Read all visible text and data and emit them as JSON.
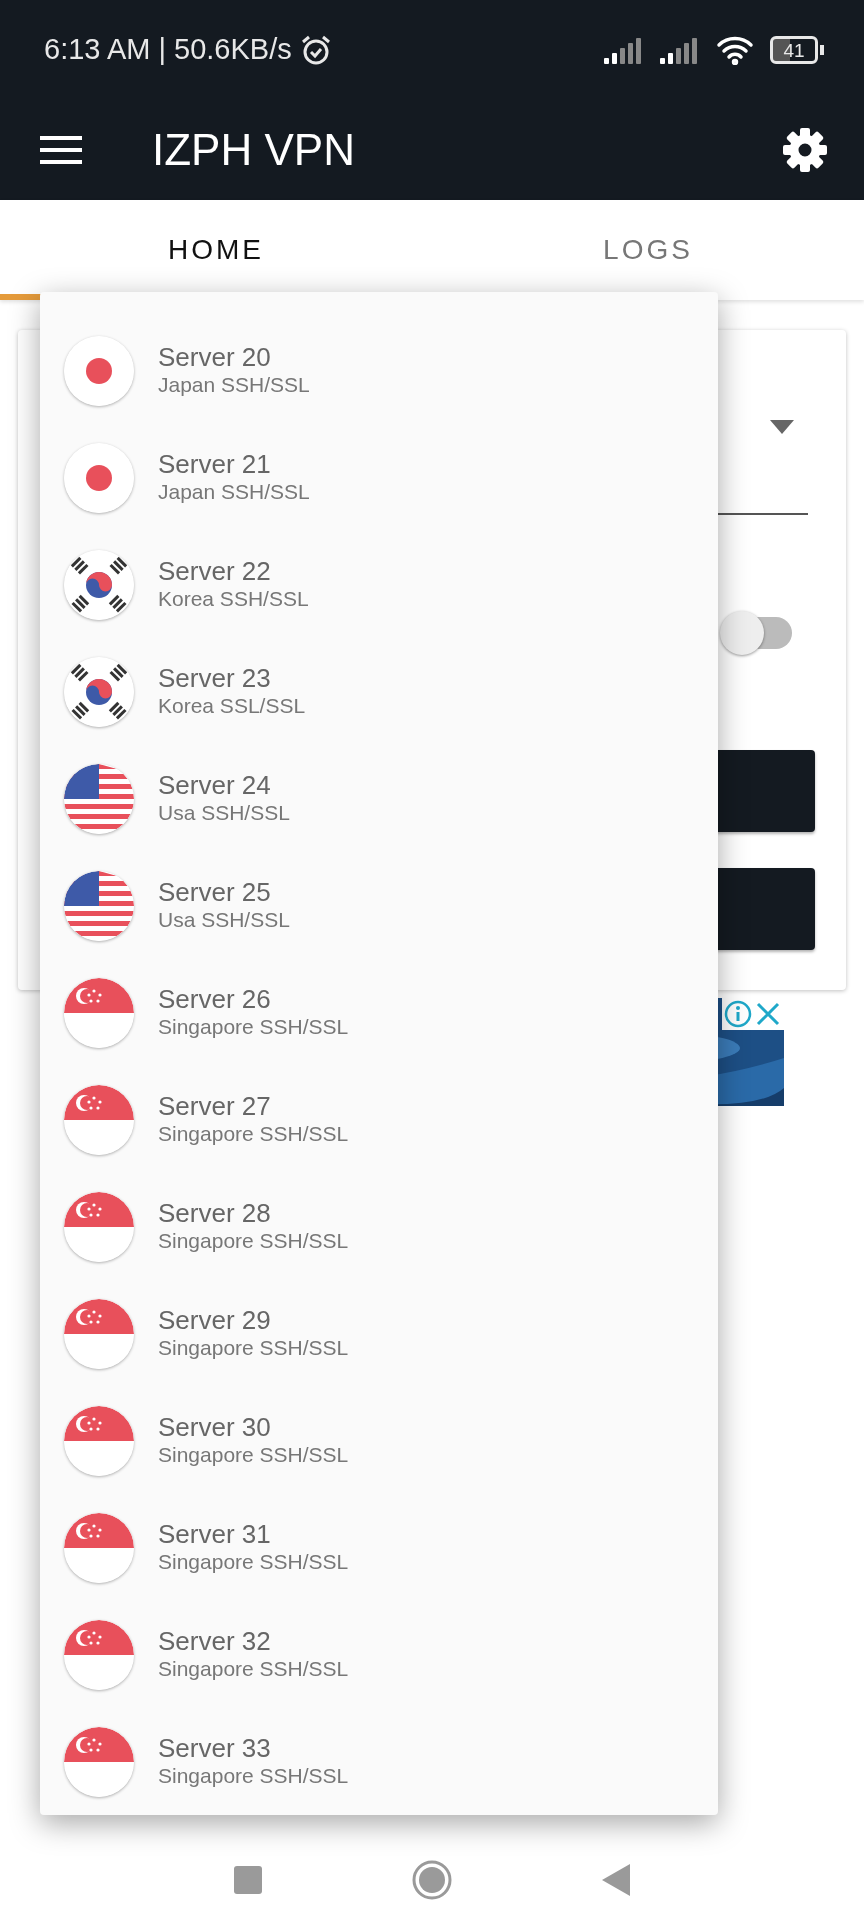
{
  "status_bar": {
    "time_speed": "6:13 AM | 50.6KB/s",
    "battery": "41"
  },
  "toolbar": {
    "title": "IZPH VPN"
  },
  "tabs": [
    {
      "label": "HOME",
      "selected": true
    },
    {
      "label": "LOGS",
      "selected": false
    }
  ],
  "home_card": {
    "toggle_on": false
  },
  "server_menu": [
    {
      "name": "Server 20",
      "protocol": "Japan SSH/SSL",
      "kind": "japan"
    },
    {
      "name": "Server 21",
      "protocol": "Japan SSH/SSL",
      "kind": "japan"
    },
    {
      "name": "Server 22",
      "protocol": "Korea SSH/SSL",
      "kind": "korea"
    },
    {
      "name": "Server 23",
      "protocol": "Korea SSL/SSL",
      "kind": "korea"
    },
    {
      "name": "Server 24",
      "protocol": "Usa SSH/SSL",
      "kind": "usa"
    },
    {
      "name": "Server 25",
      "protocol": "Usa SSH/SSL",
      "kind": "usa"
    },
    {
      "name": "Server 26",
      "protocol": "Singapore SSH/SSL",
      "kind": "singapore"
    },
    {
      "name": "Server 27",
      "protocol": "Singapore SSH/SSL",
      "kind": "singapore"
    },
    {
      "name": "Server 28",
      "protocol": "Singapore SSH/SSL",
      "kind": "singapore"
    },
    {
      "name": "Server 29",
      "protocol": "Singapore SSH/SSL",
      "kind": "singapore"
    },
    {
      "name": "Server 30",
      "protocol": "Singapore SSH/SSL",
      "kind": "singapore"
    },
    {
      "name": "Server 31",
      "protocol": "Singapore SSH/SSL",
      "kind": "singapore"
    },
    {
      "name": "Server 32",
      "protocol": "Singapore SSH/SSL",
      "kind": "singapore"
    },
    {
      "name": "Server 33",
      "protocol": "Singapore SSH/SSL",
      "kind": "singapore"
    }
  ]
}
